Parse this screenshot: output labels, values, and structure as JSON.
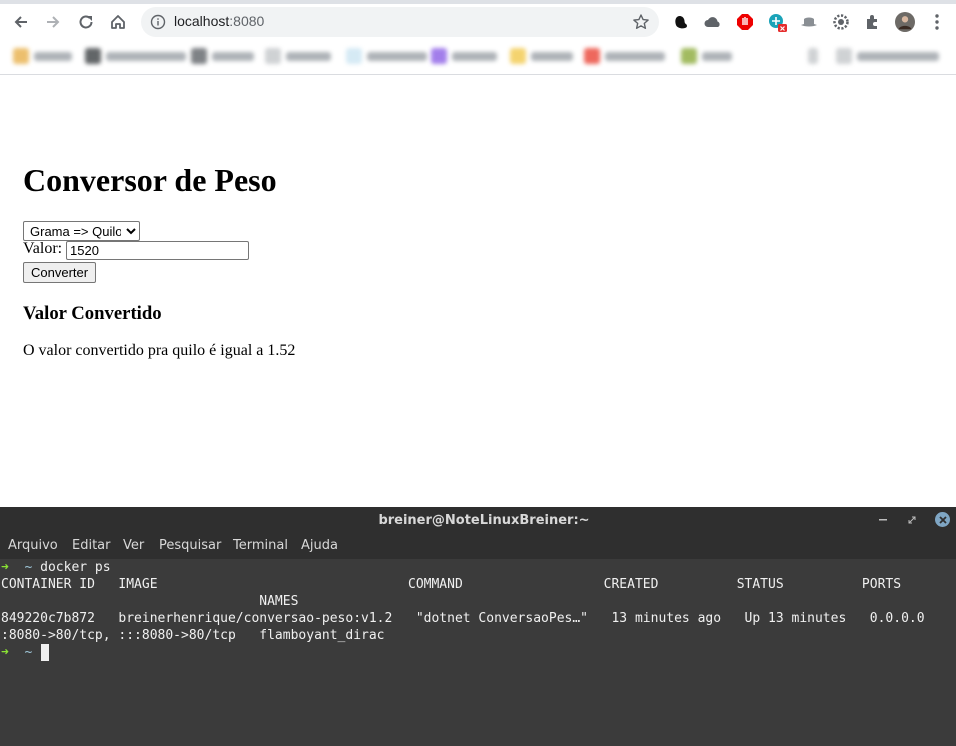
{
  "browser": {
    "url_host": "localhost",
    "url_port": ":8080"
  },
  "page": {
    "title": "Conversor de Peso",
    "select_value": "Grama => Quilo",
    "valor_label": "Valor:",
    "valor_input": "1520",
    "convert_button": "Converter",
    "result_heading": "Valor Convertido",
    "result_text": "O valor convertido pra quilo é igual a 1.52"
  },
  "terminal": {
    "title": "breiner@NoteLinuxBreiner:~",
    "menu": [
      "Arquivo",
      "Editar",
      "Ver",
      "Pesquisar",
      "Terminal",
      "Ajuda"
    ],
    "prompt_arrow": "➜",
    "prompt_dir": "~",
    "command": "docker ps",
    "header_line1": "CONTAINER ID   IMAGE                                COMMAND                  CREATED          STATUS          PORTS",
    "header_line2": "                                 NAMES",
    "row_line1": "849220c7b872   breinerhenrique/conversao-peso:v1.2   \"dotnet ConversaoPes…\"   13 minutes ago   Up 13 minutes   0.0.0.0",
    "row_line2": ":8080->80/tcp, :::8080->80/tcp   flamboyant_dirac"
  }
}
